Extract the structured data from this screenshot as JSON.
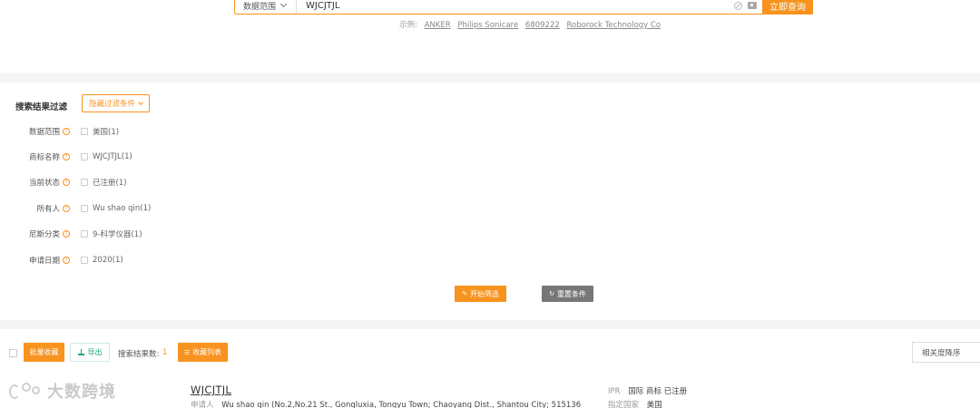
{
  "search": {
    "scope_label": "数据范围",
    "query": "WJCJTJL",
    "button_label": "立即查询"
  },
  "examples": {
    "prefix": "示例:",
    "items": [
      "ANKER",
      "Philips Sonicare",
      "6809222",
      "Roborock Technology Co"
    ]
  },
  "filters": {
    "title": "搜索结果过滤",
    "hide_button_label": "隐藏过滤条件",
    "rows": [
      {
        "label": "数据范围",
        "option": "美国(1)"
      },
      {
        "label": "商标名称",
        "option": "WJCJTJL(1)"
      },
      {
        "label": "当前状态",
        "option": "已注册(1)"
      },
      {
        "label": "所有人",
        "option": "Wu shao qin(1)"
      },
      {
        "label": "尼斯分类",
        "option": "9-科学仪器(1)"
      },
      {
        "label": "申请日期",
        "option": "2020(1)"
      }
    ],
    "help_glyph": "?",
    "start_button_label": "开始筛选",
    "reset_button_label": "重置条件"
  },
  "results": {
    "bulk_fav_label": "批量收藏",
    "export_label": "导出",
    "count_label": "搜索结果数:",
    "count": "1",
    "fav_list_label": "收藏列表",
    "sort_label": "相关度降序"
  },
  "result_card": {
    "name": "WJCJTJL",
    "applicant_label": "申请人",
    "applicant_value": "Wu shao qin (No.2,No.21 St., Gongluxia, Tongyu Town; Chaoyang Dist., Shantou City; 515136",
    "ipr_label": "IPR",
    "ipr_value": "国际 商标 已注册",
    "country_label": "指定国家",
    "country_value": "美国"
  },
  "watermark": {
    "text": "大数跨境"
  },
  "colors": {
    "accent": "#f7931e",
    "export_green": "#1aa37a",
    "reset_gray": "#777777",
    "band": "#f5f5f5"
  }
}
